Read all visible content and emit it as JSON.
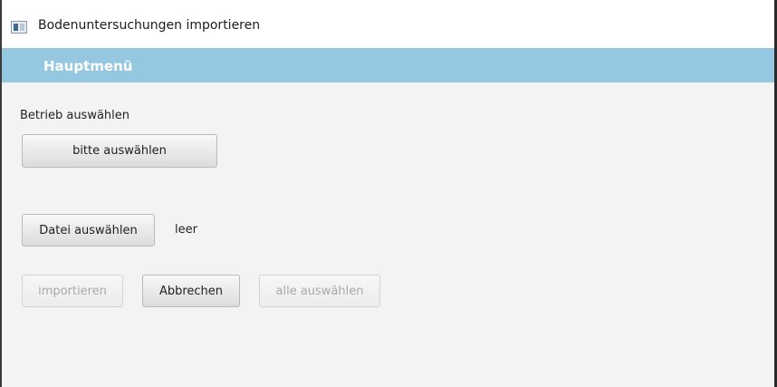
{
  "window": {
    "title": "Bodenuntersuchungen importieren",
    "icon": "app-window-icon"
  },
  "menu": {
    "items": [
      {
        "label": "Hauptmenü"
      }
    ]
  },
  "form": {
    "betrieb_label": "Betrieb auswählen",
    "betrieb_select_label": "bitte auswählen",
    "file_button_label": "Datei auswählen",
    "file_status": "leer",
    "actions": {
      "import_label": "importieren",
      "import_enabled": false,
      "cancel_label": "Abbrechen",
      "cancel_enabled": true,
      "select_all_label": "alle auswählen",
      "select_all_enabled": false
    }
  },
  "colors": {
    "menubar": "#95c7e0",
    "window_bg": "#f3f3f3"
  }
}
